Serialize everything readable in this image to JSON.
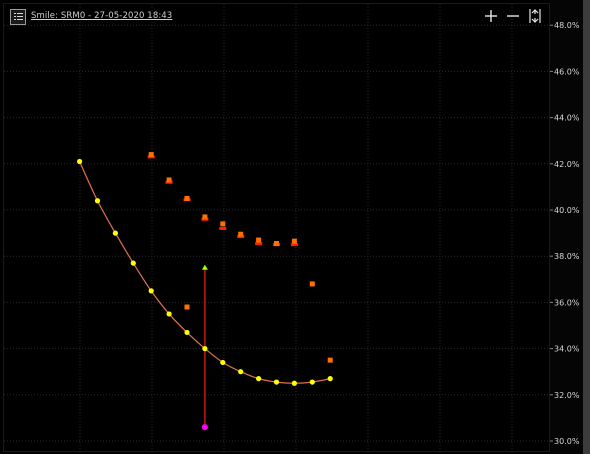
{
  "toolbar": {
    "title": "Smile: SRM0 - 27-05-2020 18:43",
    "menu_icon": "list-icon",
    "zoom_in_icon": "plus-icon",
    "zoom_out_icon": "minus-icon",
    "fit_icon": "fit-arrows-icon"
  },
  "chart_data": {
    "type": "scatter",
    "title": "Smile: SRM0 - 27-05-2020 18:43",
    "ylim": [
      29.6,
      48.6
    ],
    "y_ticks": [
      30,
      32,
      34,
      36,
      38,
      40,
      42,
      44,
      46,
      48
    ],
    "y_tick_labels": [
      "30.0%",
      "32.0%",
      "34.0%",
      "36.0%",
      "38.0%",
      "40.0%",
      "42.0%",
      "44.0%",
      "46.0%",
      "48.0%"
    ],
    "x_range": [
      0,
      23
    ],
    "grid": true,
    "colors": {
      "curve": "#e07050",
      "curve_points": "#ffff00",
      "ask_markers": "#ff7000",
      "bid_markers": "#ff2000",
      "range_line": "#cc1515",
      "range_top": "#aaff00",
      "range_bottom": "#ff00ff",
      "grid": "#2a2a2a"
    },
    "series": [
      {
        "kind": "curve",
        "x": [
          4,
          5,
          6,
          7,
          8,
          9,
          10,
          11,
          12,
          13,
          14,
          15,
          16,
          17,
          18
        ],
        "y": [
          42.1,
          40.4,
          39.0,
          37.7,
          36.5,
          35.5,
          34.7,
          34.0,
          33.4,
          33.0,
          32.7,
          32.55,
          32.5,
          32.55,
          32.7
        ]
      },
      {
        "kind": "ask",
        "x": [
          8,
          9,
          10,
          11,
          12,
          13,
          14,
          15,
          16,
          10,
          17,
          18
        ],
        "y": [
          42.4,
          41.3,
          40.5,
          39.7,
          39.4,
          38.95,
          38.7,
          38.55,
          38.65,
          35.8,
          36.8,
          33.5
        ]
      },
      {
        "kind": "bid",
        "x": [
          8,
          9,
          10,
          11,
          12,
          13,
          14,
          15,
          16
        ],
        "y": [
          42.3,
          41.2,
          40.45,
          39.6,
          39.2,
          38.85,
          38.55,
          38.5,
          38.5
        ]
      },
      {
        "kind": "range",
        "x": 11,
        "low": 30.6,
        "high": 37.5
      }
    ]
  }
}
